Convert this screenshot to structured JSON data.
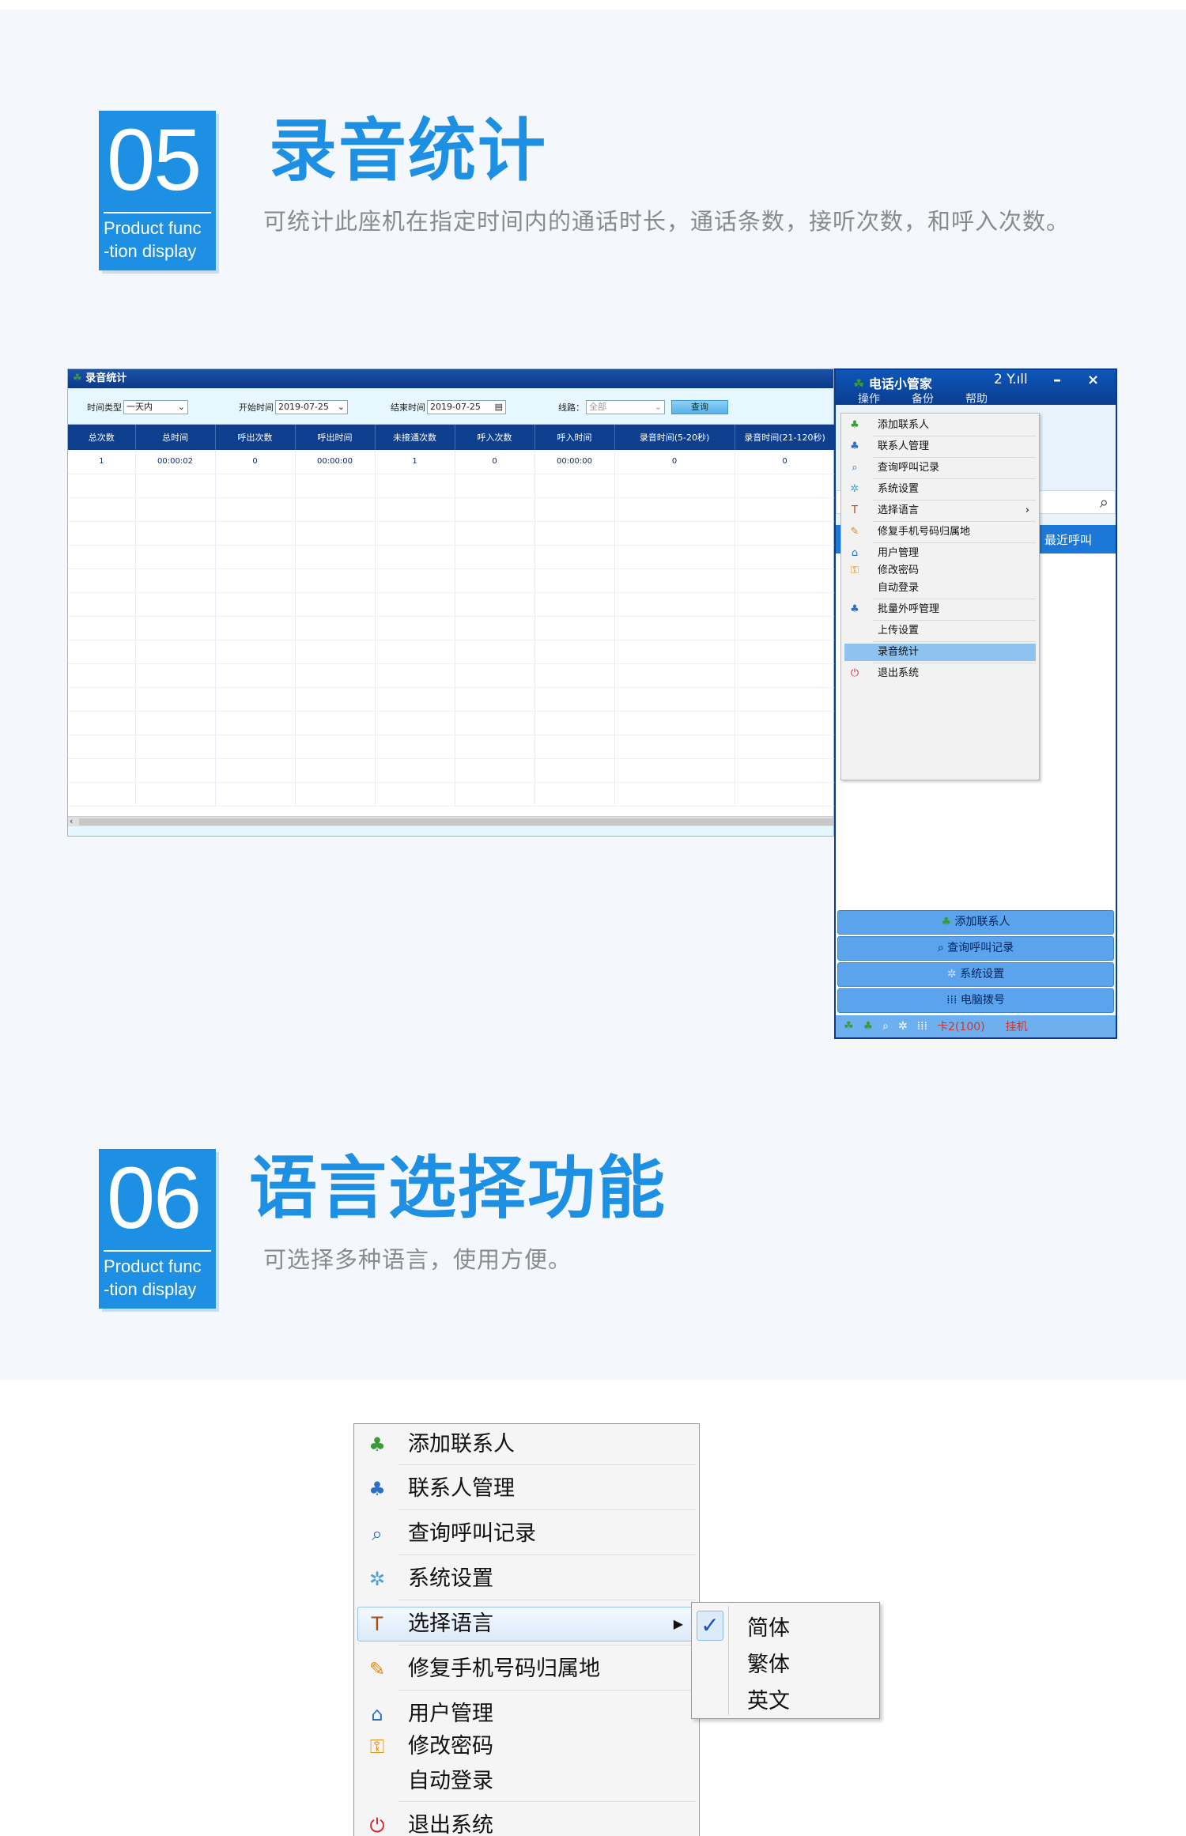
{
  "section5": {
    "number": "05",
    "tag": "Product func\n-tion display",
    "title": "录音统计",
    "subtitle": "可统计此座机在指定时间内的通话时长，通话条数，接听次数，和呼入次数。"
  },
  "section6": {
    "number": "06",
    "tag": "Product func\n-tion display",
    "title": "语言选择功能",
    "subtitle": "可选择多种语言，使用方便。"
  },
  "stats_window": {
    "title": "录音统计",
    "filters": {
      "time_type_label": "时间类型",
      "time_type_value": "一天内",
      "start_label": "开始时间",
      "start_value": "2019-07-25",
      "end_label": "结束时间",
      "end_value": "2019-07-25",
      "line_label": "线路：",
      "line_value": "全部",
      "query_button": "查询"
    },
    "columns": [
      "总次数",
      "总时间",
      "呼出次数",
      "呼出时间",
      "未接通次数",
      "呼入次数",
      "呼入时间",
      "录音时间(5-20秒)",
      "录音时间(21-120秒)"
    ],
    "rows": [
      [
        "1",
        "00:00:02",
        "0",
        "00:00:00",
        "1",
        "0",
        "00:00:00",
        "0",
        "0"
      ]
    ]
  },
  "phone": {
    "title": "电话小管家",
    "signal": "2 Y.ıll",
    "menu": [
      "操作",
      "备份",
      "帮助"
    ],
    "tab_label": "最近呼叫",
    "buttons": [
      "添加联系人",
      "查询呼叫记录",
      "系统设置",
      "电脑拨号"
    ],
    "status_card": "卡2(100)",
    "status_state": "挂机"
  },
  "context_menu": {
    "items": [
      {
        "label": "添加联系人",
        "icon": "add-contact-icon"
      },
      {
        "label": "联系人管理",
        "icon": "contacts-icon"
      },
      {
        "label": "查询呼叫记录",
        "icon": "magnifier-icon"
      },
      {
        "label": "系统设置",
        "icon": "gear-icon"
      },
      {
        "label": "选择语言",
        "icon": "font-icon"
      },
      {
        "label": "修复手机号码归属地",
        "icon": "edit-icon"
      },
      {
        "label": "用户管理",
        "icon": "user-icon"
      },
      {
        "label": "修改密码",
        "icon": "key-icon"
      },
      {
        "label": "自动登录",
        "icon": ""
      },
      {
        "label": "批量外呼管理",
        "icon": "batch-call-icon"
      },
      {
        "label": "上传设置",
        "icon": ""
      },
      {
        "label": "录音统计",
        "icon": ""
      },
      {
        "label": "退出系统",
        "icon": "power-icon"
      }
    ]
  },
  "language_menu": {
    "items": [
      "添加联系人",
      "联系人管理",
      "查询呼叫记录",
      "系统设置",
      "选择语言",
      "修复手机号码归属地",
      "用户管理",
      "修改密码",
      "自动登录",
      "退出系统"
    ],
    "submenu": [
      "简体",
      "繁体",
      "英文"
    ]
  },
  "colors": {
    "accent": "#1e90e3",
    "titlebar": "#0e3f8f"
  }
}
